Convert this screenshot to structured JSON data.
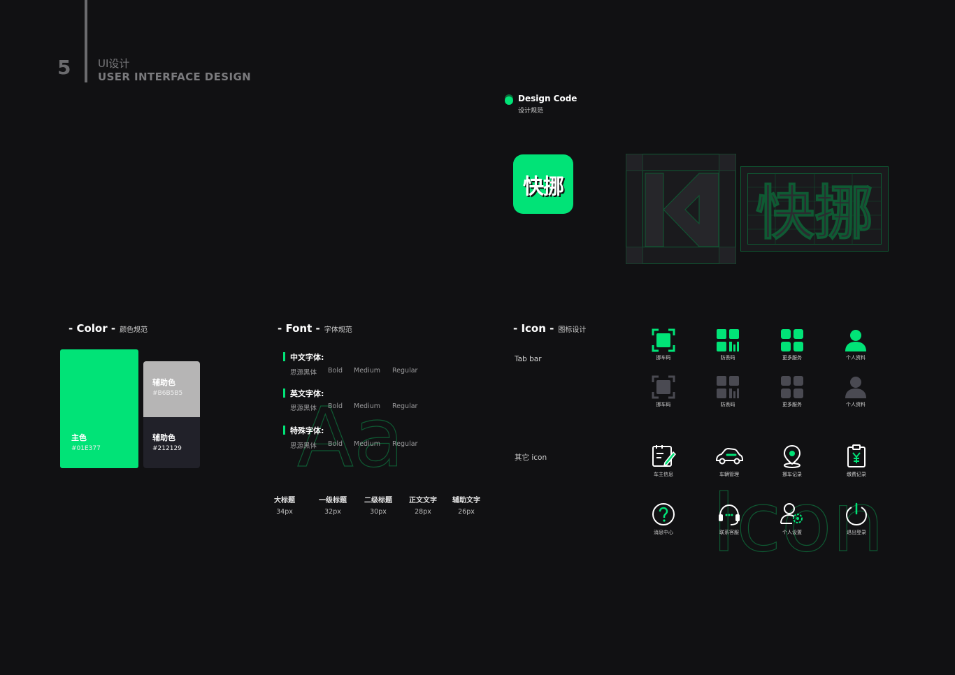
{
  "header": {
    "page_number": "5",
    "title_cn": "UI设计",
    "title_en": "USER INTERFACE DESIGN"
  },
  "design_code": {
    "title": "Design Code",
    "subtitle": "设计规范"
  },
  "app_icon": {
    "text": "快挪",
    "color": "#01E377"
  },
  "color_section": {
    "title": "- Color -",
    "subtitle": "颜色规范",
    "swatches": [
      {
        "name": "主色",
        "hex": "#01E377"
      },
      {
        "name": "辅助色",
        "hex": "#B6B5B5"
      },
      {
        "name": "辅助色",
        "hex": "#212129"
      }
    ]
  },
  "font_section": {
    "title": "- Font -",
    "subtitle": "字体规范",
    "watermark": "Aa",
    "groups": [
      {
        "label": "中文字体:",
        "family": "思源黑体",
        "weights": [
          "Bold",
          "Medium",
          "Regular"
        ]
      },
      {
        "label": "英文字体:",
        "family": "思源黑体",
        "weights": [
          "Bold",
          "Medium",
          "Regular"
        ]
      },
      {
        "label": "特殊字体:",
        "family": "思源黑体",
        "weights": [
          "Bold",
          "Medium",
          "Regular"
        ]
      }
    ],
    "sizes": [
      {
        "name": "大标题",
        "value": "34px"
      },
      {
        "name": "一级标题",
        "value": "32px"
      },
      {
        "name": "二级标题",
        "value": "30px"
      },
      {
        "name": "正文文字",
        "value": "28px"
      },
      {
        "name": "辅助文字",
        "value": "26px"
      }
    ]
  },
  "icon_section": {
    "title": "- Icon -",
    "subtitle": "图标设计",
    "watermark": "Icon",
    "tab_bar_label": "Tab bar",
    "other_label": "其它 icon",
    "tab_active": [
      {
        "icon": "scan-icon",
        "label": "挪车码"
      },
      {
        "icon": "qrcode-icon",
        "label": "防丢码"
      },
      {
        "icon": "grid-icon",
        "label": "更多服务"
      },
      {
        "icon": "user-icon",
        "label": "个人资料"
      }
    ],
    "tab_inactive": [
      {
        "icon": "scan-icon",
        "label": "挪车码"
      },
      {
        "icon": "qrcode-icon",
        "label": "防丢码"
      },
      {
        "icon": "grid-icon",
        "label": "更多服务"
      },
      {
        "icon": "user-icon",
        "label": "个人资料"
      }
    ],
    "other_row1": [
      {
        "icon": "edit-note-icon",
        "label": "车主信息"
      },
      {
        "icon": "car-icon",
        "label": "车辆管理"
      },
      {
        "icon": "location-icon",
        "label": "挪车记录"
      },
      {
        "icon": "yuan-clipboard-icon",
        "label": "缴费记录"
      }
    ],
    "other_row2": [
      {
        "icon": "help-icon",
        "label": "消息中心"
      },
      {
        "icon": "headset-icon",
        "label": "联系客服"
      },
      {
        "icon": "user-settings-icon",
        "label": "个人设置"
      },
      {
        "icon": "power-icon",
        "label": "退出登录"
      }
    ],
    "colors": {
      "active": "#01E377",
      "inactive": "#4a4a52",
      "outline": "#ffffff"
    }
  }
}
